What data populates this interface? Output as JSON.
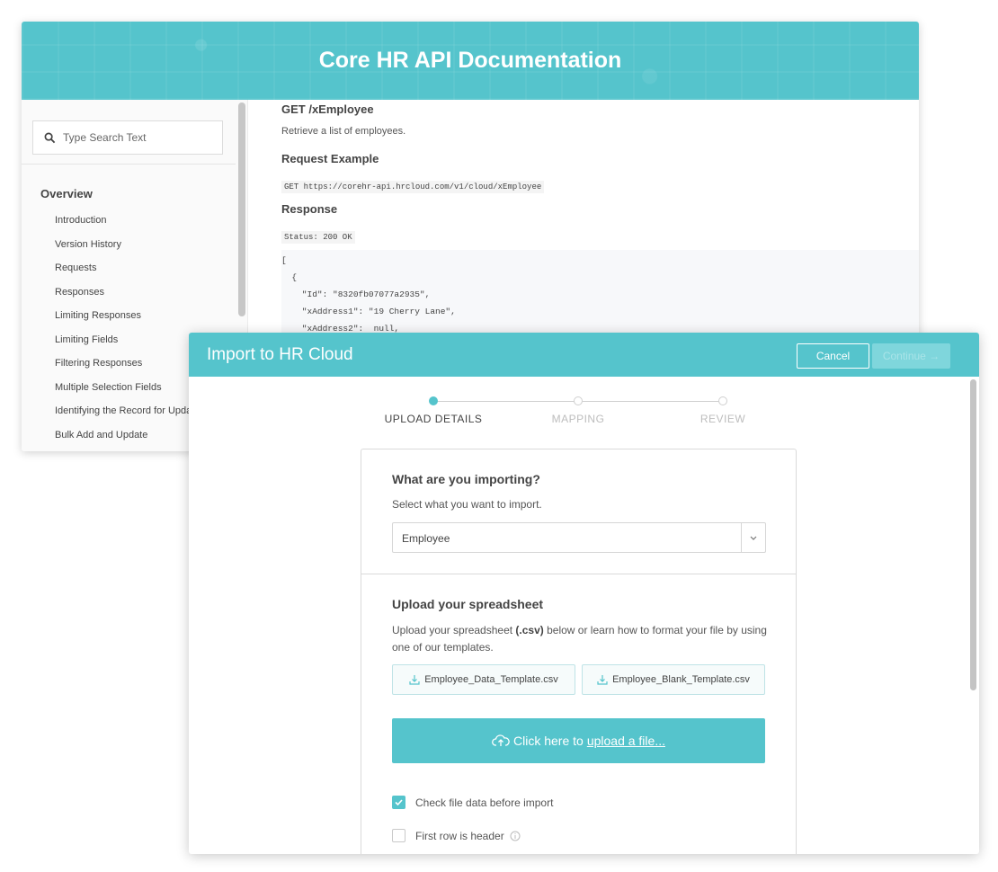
{
  "docs": {
    "title": "Core HR API Documentation",
    "search_placeholder": "Type Search Text",
    "section_title": "Overview",
    "nav_items": [
      "Introduction",
      "Version History",
      "Requests",
      "Responses",
      "Limiting Responses",
      "Limiting Fields",
      "Filtering Responses",
      "Multiple Selection Fields",
      "Identifying the Record for Upda",
      "Bulk Add and Update"
    ],
    "endpoint_heading": "GET /xEmployee",
    "endpoint_description": "Retrieve a list of employees.",
    "request_heading": "Request Example",
    "request_code": "GET https://corehr-api.hrcloud.com/v1/cloud/xEmployee",
    "response_heading": "Response",
    "status_code": "Status: 200 OK",
    "json_lines": [
      "[",
      "  {",
      "    \"Id\": \"8320fb07077a2935\",",
      "    \"xAddress1\": \"19 Cherry Lane\",",
      "    \"xAddress2\":  null,"
    ]
  },
  "modal": {
    "title": "Import to HR Cloud",
    "cancel_label": "Cancel",
    "continue_label": "Continue →",
    "steps": [
      {
        "label": "UPLOAD DETAILS",
        "active": true
      },
      {
        "label": "MAPPING",
        "active": false
      },
      {
        "label": "REVIEW",
        "active": false
      }
    ],
    "import_question": "What are you importing?",
    "import_sub": "Select what you want to import.",
    "import_selected": "Employee",
    "upload_title": "Upload your spreadsheet",
    "upload_desc_pre": "Upload your spreadsheet ",
    "upload_desc_bold": "(.csv)",
    "upload_desc_post": " below or learn how to format your file by using one of our templates.",
    "template_1": "Employee_Data_Template.csv",
    "template_2": "Employee_Blank_Template.csv",
    "upload_prefix": "Click here to",
    "upload_link": "upload a file...",
    "check_data_label": "Check file data before import",
    "check_data_checked": true,
    "header_row_label": "First row is header",
    "header_row_checked": false
  },
  "colors": {
    "accent": "#55c4cc"
  }
}
